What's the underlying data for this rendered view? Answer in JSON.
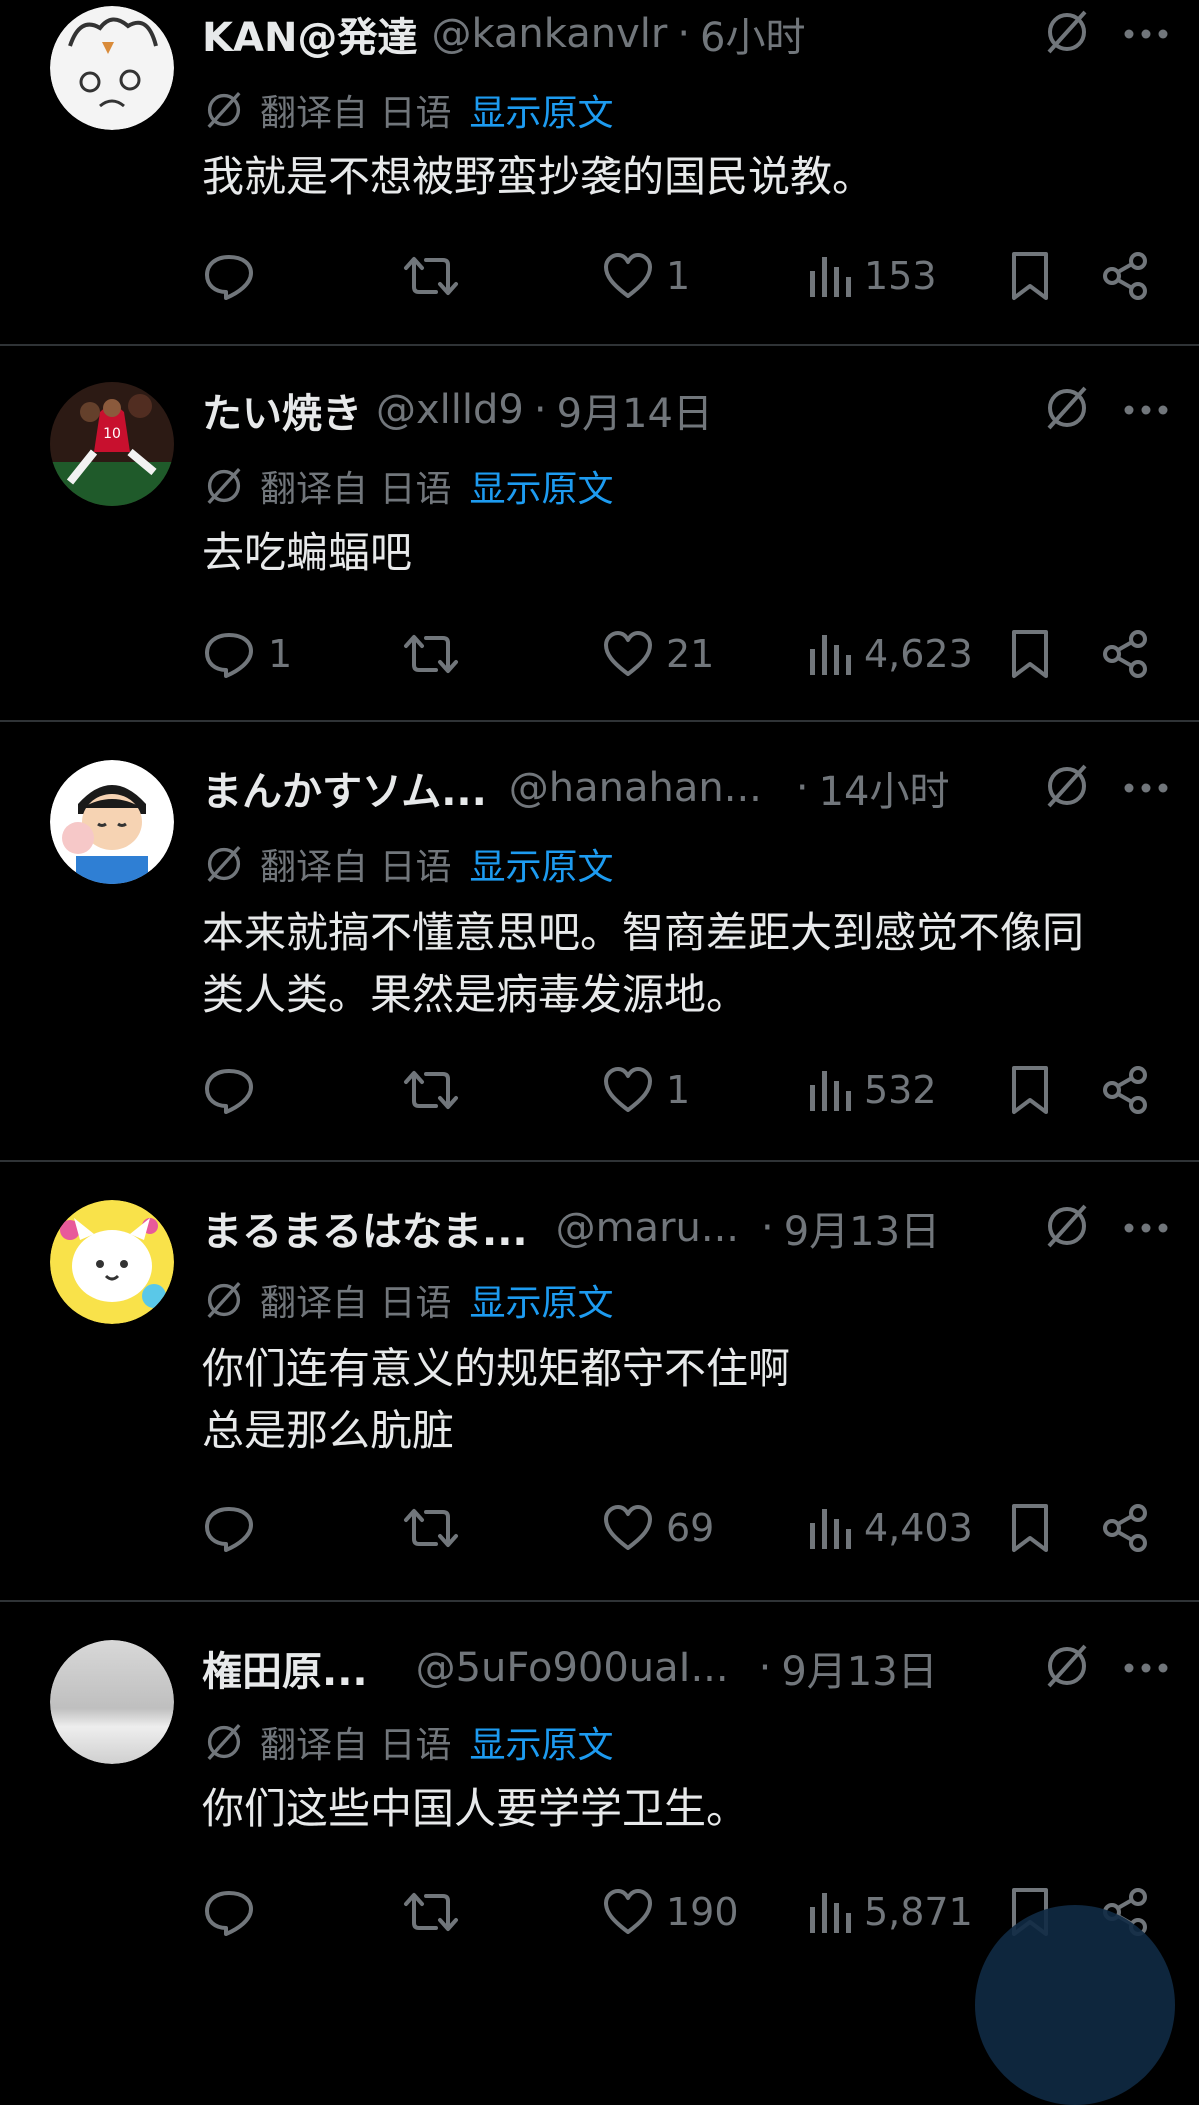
{
  "translate_label": "翻译自 日语",
  "show_original_label": "显示原文",
  "tweets": [
    {
      "name": "KAN@発達",
      "handle": "@kankanvlr",
      "time": "6小时",
      "text": "我就是不想被野蛮抄袭的国民说教。",
      "replies": "",
      "likes": "1",
      "views": "153"
    },
    {
      "name": "たい焼き",
      "handle": "@xllld9",
      "time": "9月14日",
      "text": "去吃蝙蝠吧",
      "replies": "1",
      "likes": "21",
      "views": "4,623"
    },
    {
      "name": "まんかすソム...",
      "handle": "@hanahan...",
      "time": "14小时",
      "text": "本来就搞不懂意思吧。智商差距大到感觉不像同类人类。果然是病毒发源地。",
      "replies": "",
      "likes": "1",
      "views": "532"
    },
    {
      "name": "まるまるはなま...",
      "handle": "@maru...",
      "time": "9月13日",
      "text": "你们连有意义的规矩都守不住啊\n总是那么肮脏",
      "replies": "",
      "likes": "69",
      "views": "4,403"
    },
    {
      "name": "権田原...",
      "handle": "@5uFo900uaI...",
      "time": "9月13日",
      "text": "你们这些中国人要学学卫生。",
      "replies": "",
      "likes": "190",
      "views": "5,871"
    }
  ]
}
